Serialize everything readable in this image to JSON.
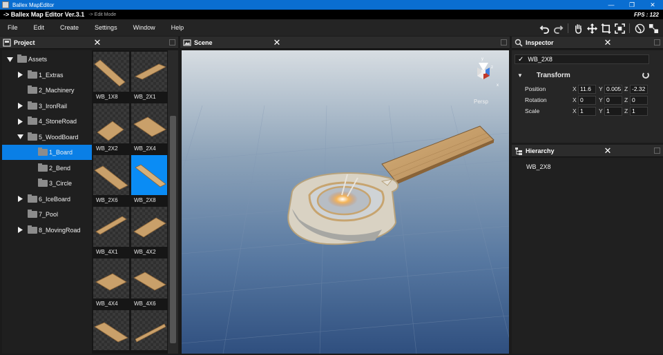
{
  "window": {
    "title": "Ballex MapEditor"
  },
  "header": {
    "version": "-> Ballex Map Editor Ver.3.1",
    "mode": "-> Edit Mode",
    "fps": "FPS : 122"
  },
  "menu": [
    "File",
    "Edit",
    "Create",
    "Settings",
    "Window",
    "Help"
  ],
  "toolbar": [
    "undo-icon",
    "redo-icon",
    "hand-icon",
    "move-icon",
    "rotate-icon",
    "scale-icon",
    "global-icon",
    "pivot-icon"
  ],
  "project": {
    "title": "Project",
    "tree": [
      {
        "label": "Assets",
        "level": 0,
        "expanded": true
      },
      {
        "label": "1_Extras",
        "level": 1,
        "expandable": true
      },
      {
        "label": "2_Machinery",
        "level": 1,
        "expandable": false
      },
      {
        "label": "3_IronRail",
        "level": 1,
        "expandable": true
      },
      {
        "label": "4_StoneRoad",
        "level": 1,
        "expandable": true
      },
      {
        "label": "5_WoodBoard",
        "level": 1,
        "expanded": true
      },
      {
        "label": "1_Board",
        "level": 2,
        "selected": true
      },
      {
        "label": "2_Bend",
        "level": 2
      },
      {
        "label": "3_Circle",
        "level": 2
      },
      {
        "label": "6_IceBoard",
        "level": 1,
        "expandable": true
      },
      {
        "label": "7_Pool",
        "level": 1,
        "expandable": false
      },
      {
        "label": "8_MovingRoad",
        "level": 1,
        "expandable": true
      }
    ],
    "assets": [
      {
        "label": "WB_1X8"
      },
      {
        "label": "WB_2X1"
      },
      {
        "label": "WB_2X2"
      },
      {
        "label": "WB_2X4"
      },
      {
        "label": "WB_2X6"
      },
      {
        "label": "WB_2X8",
        "selected": true
      },
      {
        "label": "WB_4X1"
      },
      {
        "label": "WB_4X2"
      },
      {
        "label": "WB_4X4"
      },
      {
        "label": "WB_4X6"
      },
      {
        "label": ""
      },
      {
        "label": ""
      }
    ]
  },
  "scene": {
    "title": "Scene",
    "view_label": "Persp",
    "gizmo_axes": [
      "y",
      "z",
      "x"
    ]
  },
  "inspector": {
    "title": "Inspector",
    "object_name": "WB_2X8",
    "active": true,
    "component": "Transform",
    "position": {
      "label": "Position",
      "x": "11.6",
      "y": "0.005",
      "z": "-2.32"
    },
    "rotation": {
      "label": "Rotation",
      "x": "0",
      "y": "0",
      "z": "0"
    },
    "scale": {
      "label": "Scale",
      "x": "1",
      "y": "1",
      "z": "1"
    }
  },
  "hierarchy": {
    "title": "Hierarchy",
    "items": [
      "WB_2X8"
    ]
  },
  "colors": {
    "accent": "#0a7fe6",
    "titlebar": "#0a6ed1",
    "panel": "#262626",
    "wood": "#c9a06a"
  }
}
